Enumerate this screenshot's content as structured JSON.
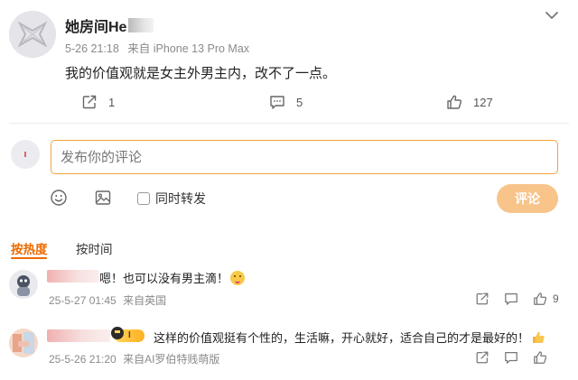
{
  "post": {
    "author": "她房间He",
    "date": "5-26 21:18",
    "source": "来自 iPhone 13 Pro Max",
    "content": "我的价值观就是女主外男主内，改不了一点。",
    "actions": {
      "repost_count": "1",
      "comment_count": "5",
      "like_count": "127"
    }
  },
  "compose": {
    "placeholder": "发布你的评论",
    "also_repost_label": "同时转发",
    "submit_label": "评论"
  },
  "sort": {
    "hot_label": "按热度",
    "time_label": "按时间"
  },
  "replies": [
    {
      "text": "嗯！也可以没有男主滴！",
      "date": "25-5-27 01:45",
      "source": "来自英国",
      "like_count": "9"
    },
    {
      "badge": "I",
      "text": "这样的价值观挺有个性的，生活嘛，开心就好，适合自己的才是最好的！",
      "date": "25-5-26 21:20",
      "source": "来自AI罗伯特贱萌版",
      "like_count": ""
    }
  ],
  "icons": {
    "repost": "share-icon",
    "comment": "comment-icon",
    "like": "thumb-up-icon",
    "emoji": "emoji-icon",
    "image": "image-icon",
    "more": "chevron-down-icon"
  },
  "colors": {
    "accent": "#ec6a00",
    "input_border": "#f3a33b",
    "submit_bg": "#f8c48a",
    "meta_text": "#8a8a8a"
  }
}
